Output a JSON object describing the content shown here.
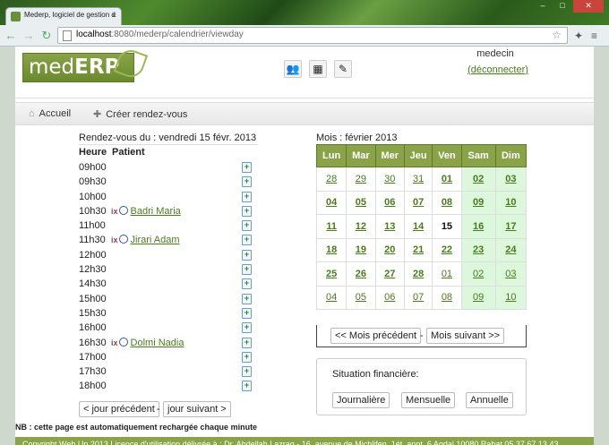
{
  "browser": {
    "tab_title": "Mederp, logiciel de gestion d",
    "url_host": "localhost",
    "url_rest": ":8080/mederp/calendrier/viewday",
    "tab_close": "×",
    "back_glyph": "←",
    "forward_glyph": "→",
    "reload_glyph": "↻",
    "star_glyph": "☆",
    "menu_glyph": "≡",
    "wc_min": "–",
    "wc_max": "□",
    "wc_close": "✕"
  },
  "header": {
    "logo_med": "med",
    "logo_erp": "ERP",
    "user": "medecin",
    "logout_label": "(déconnecter)"
  },
  "menu": {
    "home_label": "Accueil",
    "create_label": "Créer rendez-vous"
  },
  "day": {
    "title": "Rendez-vous du : vendredi 15 févr. 2013",
    "col_hour": "Heure",
    "col_patient": "Patient",
    "slots": [
      {
        "time": "09h00",
        "patient": ""
      },
      {
        "time": "09h30",
        "patient": ""
      },
      {
        "time": "10h00",
        "patient": ""
      },
      {
        "time": "10h30",
        "patient": "Badri Maria"
      },
      {
        "time": "11h00",
        "patient": ""
      },
      {
        "time": "11h30",
        "patient": "Jirari Adam"
      },
      {
        "time": "12h00",
        "patient": ""
      },
      {
        "time": "12h30",
        "patient": ""
      },
      {
        "time": "14h30",
        "patient": ""
      },
      {
        "time": "15h00",
        "patient": ""
      },
      {
        "time": "15h30",
        "patient": ""
      },
      {
        "time": "16h00",
        "patient": ""
      },
      {
        "time": "16h30",
        "patient": "Dolmi Nadia"
      },
      {
        "time": "17h00",
        "patient": ""
      },
      {
        "time": "17h30",
        "patient": ""
      },
      {
        "time": "18h00",
        "patient": ""
      }
    ],
    "prev_label": "< jour précédent",
    "next_label": "jour suivant >",
    "separator": "-"
  },
  "nb_text": "NB : cette page est automatiquement rechargée chaque minute",
  "calendar": {
    "title": "Mois : février 2013",
    "weekdays": [
      "Lun",
      "Mar",
      "Mer",
      "Jeu",
      "Ven",
      "Sam",
      "Dim"
    ],
    "weeks": [
      [
        "28",
        "29",
        "30",
        "31",
        "01",
        "02",
        "03"
      ],
      [
        "04",
        "05",
        "06",
        "07",
        "08",
        "09",
        "10"
      ],
      [
        "11",
        "12",
        "13",
        "14",
        "15",
        "16",
        "17"
      ],
      [
        "18",
        "19",
        "20",
        "21",
        "22",
        "23",
        "24"
      ],
      [
        "25",
        "26",
        "27",
        "28",
        "01",
        "02",
        "03"
      ],
      [
        "04",
        "05",
        "06",
        "07",
        "08",
        "09",
        "10"
      ]
    ],
    "prev_label": "<< Mois précédent",
    "next_label": "Mois suivant >>",
    "separator": "-"
  },
  "finance": {
    "label": "Situation financière:",
    "daily": "Journalière",
    "monthly": "Mensuelle",
    "yearly": "Annuelle"
  },
  "footer": {
    "text": "Copyright Web Up 2013       Licence d'utilisation délivrée à : Dr. Abdellah Lazrag - 16, avenue de Michlifen, 1ét. appt. 6 Agdal 10080 Rabat 05 37 67 13 43"
  },
  "colors": {
    "brand_green": "#8aa248",
    "link_green": "#4a7a1e",
    "weekend_bg": "#dcf7dc"
  }
}
